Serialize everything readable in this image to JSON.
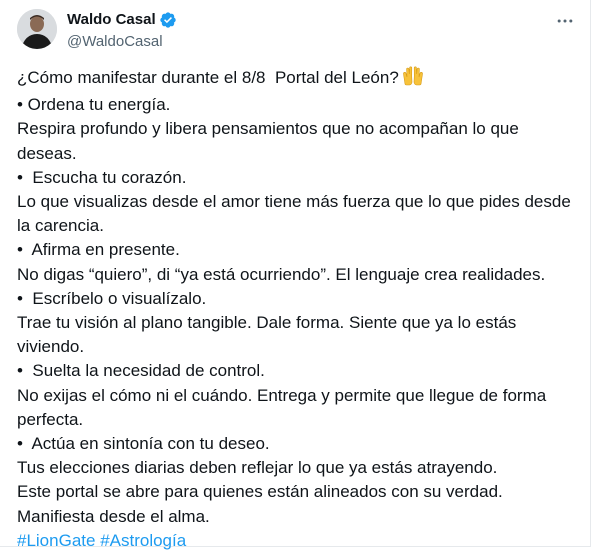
{
  "author": {
    "name": "Waldo Casal",
    "handle": "@WaldoCasal",
    "verified": true
  },
  "tweet": {
    "first_line": "¿Cómo manifestar durante el 8/8  Portal del León?",
    "first_line_emoji": "raising-hands-emoji",
    "lines": [
      "• Ordena tu energía.",
      "Respira profundo y libera pensamientos que no acompañan lo que",
      "deseas.",
      "•  Escucha tu corazón.",
      "Lo que visualizas desde el amor tiene más fuerza que lo que pides desde",
      "la carencia.",
      "•  Afirma en presente.",
      "No digas “quiero”, di “ya está ocurriendo”. El lenguaje crea realidades.",
      "•  Escríbelo o visualízalo.",
      "Trae tu visión al plano tangible. Dale forma. Siente que ya lo estás",
      "viviendo.",
      "•  Suelta la necesidad de control.",
      "No exijas el cómo ni el cuándo. Entrega y permite que llegue de forma",
      "perfecta.",
      "•  Actúa en sintonía con tu deseo.",
      "Tus elecciones diarias deben reflejar lo que ya estás atrayendo.",
      "Este portal se abre para quienes están alineados con su verdad.",
      "Manifiesta desde el alma."
    ],
    "hashtags": [
      "#LionGate",
      "#Astrología"
    ]
  },
  "colors": {
    "text": "#0f1419",
    "secondary": "#536471",
    "link": "#1d9bf0",
    "verified_badge": "#1d9bf0"
  },
  "icons": {
    "more": "more-horizontal-icon",
    "verified": "verified-badge-icon"
  }
}
